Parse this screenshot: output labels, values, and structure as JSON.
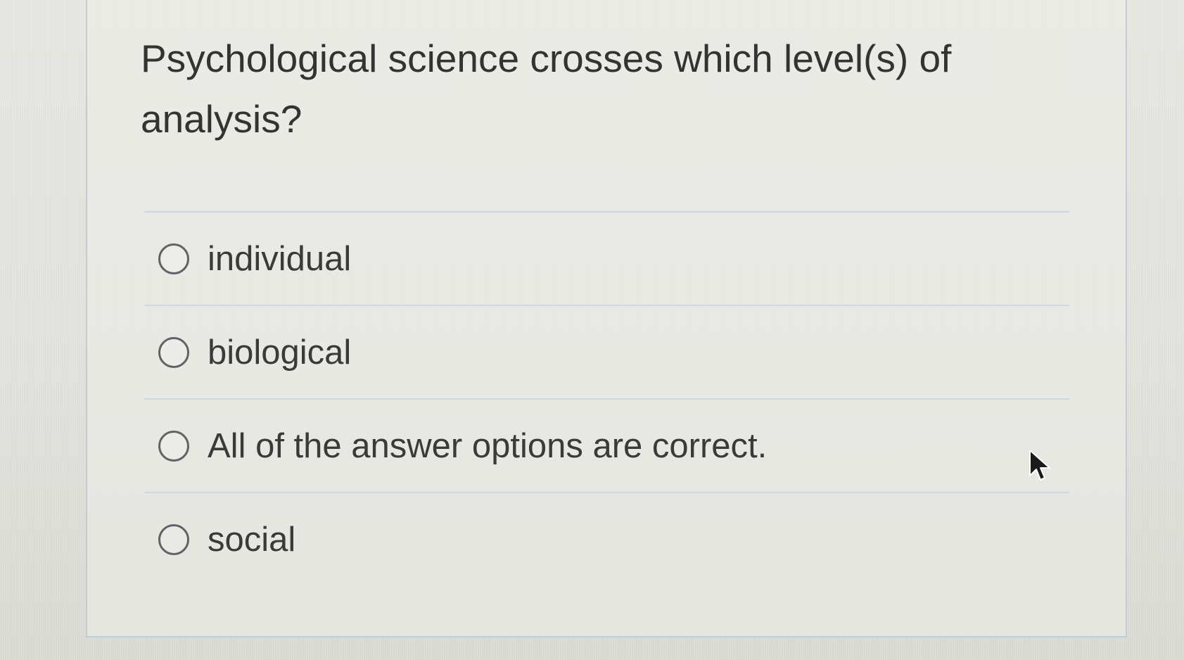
{
  "question": {
    "text": "Psychological science crosses which level(s) of analysis?"
  },
  "options": [
    {
      "label": "individual",
      "selected": false
    },
    {
      "label": "biological",
      "selected": false
    },
    {
      "label": "All of the answer options are correct.",
      "selected": false
    },
    {
      "label": "social",
      "selected": false
    }
  ],
  "cursor": {
    "icon": "mouse-pointer-icon"
  },
  "colors": {
    "background": "#e6e6e1",
    "text": "#333333",
    "divider": "#cfd6df",
    "radio_border": "#5f6266"
  }
}
